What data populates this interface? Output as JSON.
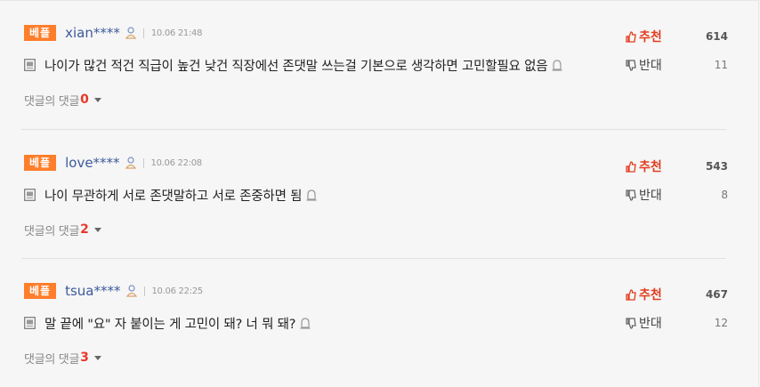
{
  "comments": [
    {
      "badge": "베플",
      "author": "xian****",
      "time": "10.06 21:48",
      "text": "나이가 많건 적건 직급이 높건 낮건 직장에선 존댓말 쓰는걸 기본으로 생각하면 고민할필요 없음",
      "replies_label": "댓글의 댓글",
      "replies_count": "0",
      "up_label": "추천",
      "up_count": "614",
      "down_label": "반대",
      "down_count": "11"
    },
    {
      "badge": "베플",
      "author": "love****",
      "time": "10.06 22:08",
      "text": "나이 무관하게 서로 존댓말하고 서로 존중하면 됨",
      "replies_label": "댓글의 댓글",
      "replies_count": "2",
      "up_label": "추천",
      "up_count": "543",
      "down_label": "반대",
      "down_count": "8"
    },
    {
      "badge": "베플",
      "author": "tsua****",
      "time": "10.06 22:25",
      "text": "말 끝에 \"요\" 자 붙이는 게 고민이 돼? 너 뭐 돼?",
      "replies_label": "댓글의 댓글",
      "replies_count": "3",
      "up_label": "추천",
      "up_count": "467",
      "down_label": "반대",
      "down_count": "12"
    }
  ],
  "colors": {
    "badge": "#ff7e2b",
    "author": "#3d5a9a",
    "recommend": "#e23d1f",
    "reply_count": "#e8382b"
  },
  "icons": [
    "person-icon",
    "document-icon",
    "report-icon",
    "thumbs-up-icon",
    "thumbs-down-icon",
    "caret-down-icon"
  ]
}
